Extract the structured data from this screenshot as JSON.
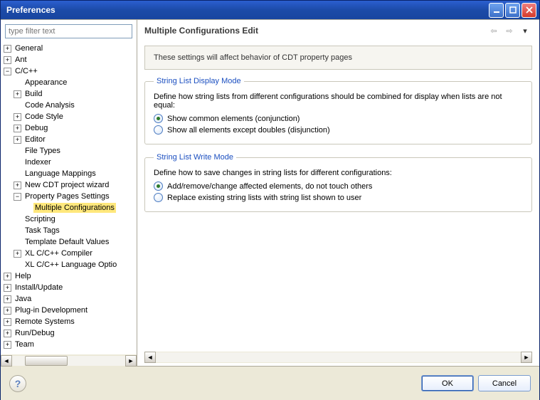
{
  "window": {
    "title": "Preferences"
  },
  "sidebar": {
    "filter_placeholder": "type filter text",
    "items": {
      "general": "General",
      "ant": "Ant",
      "ccpp": "C/C++",
      "appearance": "Appearance",
      "build": "Build",
      "code_analysis": "Code Analysis",
      "code_style": "Code Style",
      "debug": "Debug",
      "editor": "Editor",
      "file_types": "File Types",
      "indexer": "Indexer",
      "lang_mappings": "Language Mappings",
      "new_cdt_wizard": "New CDT project wizard",
      "prop_pages": "Property Pages Settings",
      "multi_config": "Multiple Configurations",
      "scripting": "Scripting",
      "task_tags": "Task Tags",
      "template_defaults": "Template Default Values",
      "xl_compiler": "XL C/C++ Compiler",
      "xl_lang_opts": "XL C/C++ Language Optio",
      "help": "Help",
      "install_update": "Install/Update",
      "java": "Java",
      "plugin_dev": "Plug-in Development",
      "remote_systems": "Remote Systems",
      "run_debug": "Run/Debug",
      "team": "Team"
    }
  },
  "main": {
    "title": "Multiple Configurations Edit",
    "banner": "These settings will affect behavior of CDT property pages",
    "group1": {
      "legend": "String List Display Mode",
      "desc": "Define how string lists from different configurations should be combined for display when lists are not equal:",
      "opt1": "Show common elements (conjunction)",
      "opt2": "Show all elements except doubles (disjunction)"
    },
    "group2": {
      "legend": "String List Write Mode",
      "desc": "Define how to save changes in string lists for different configurations:",
      "opt1": "Add/remove/change affected elements, do not touch others",
      "opt2": "Replace existing string lists with string list shown to user"
    }
  },
  "buttons": {
    "ok": "OK",
    "cancel": "Cancel"
  }
}
